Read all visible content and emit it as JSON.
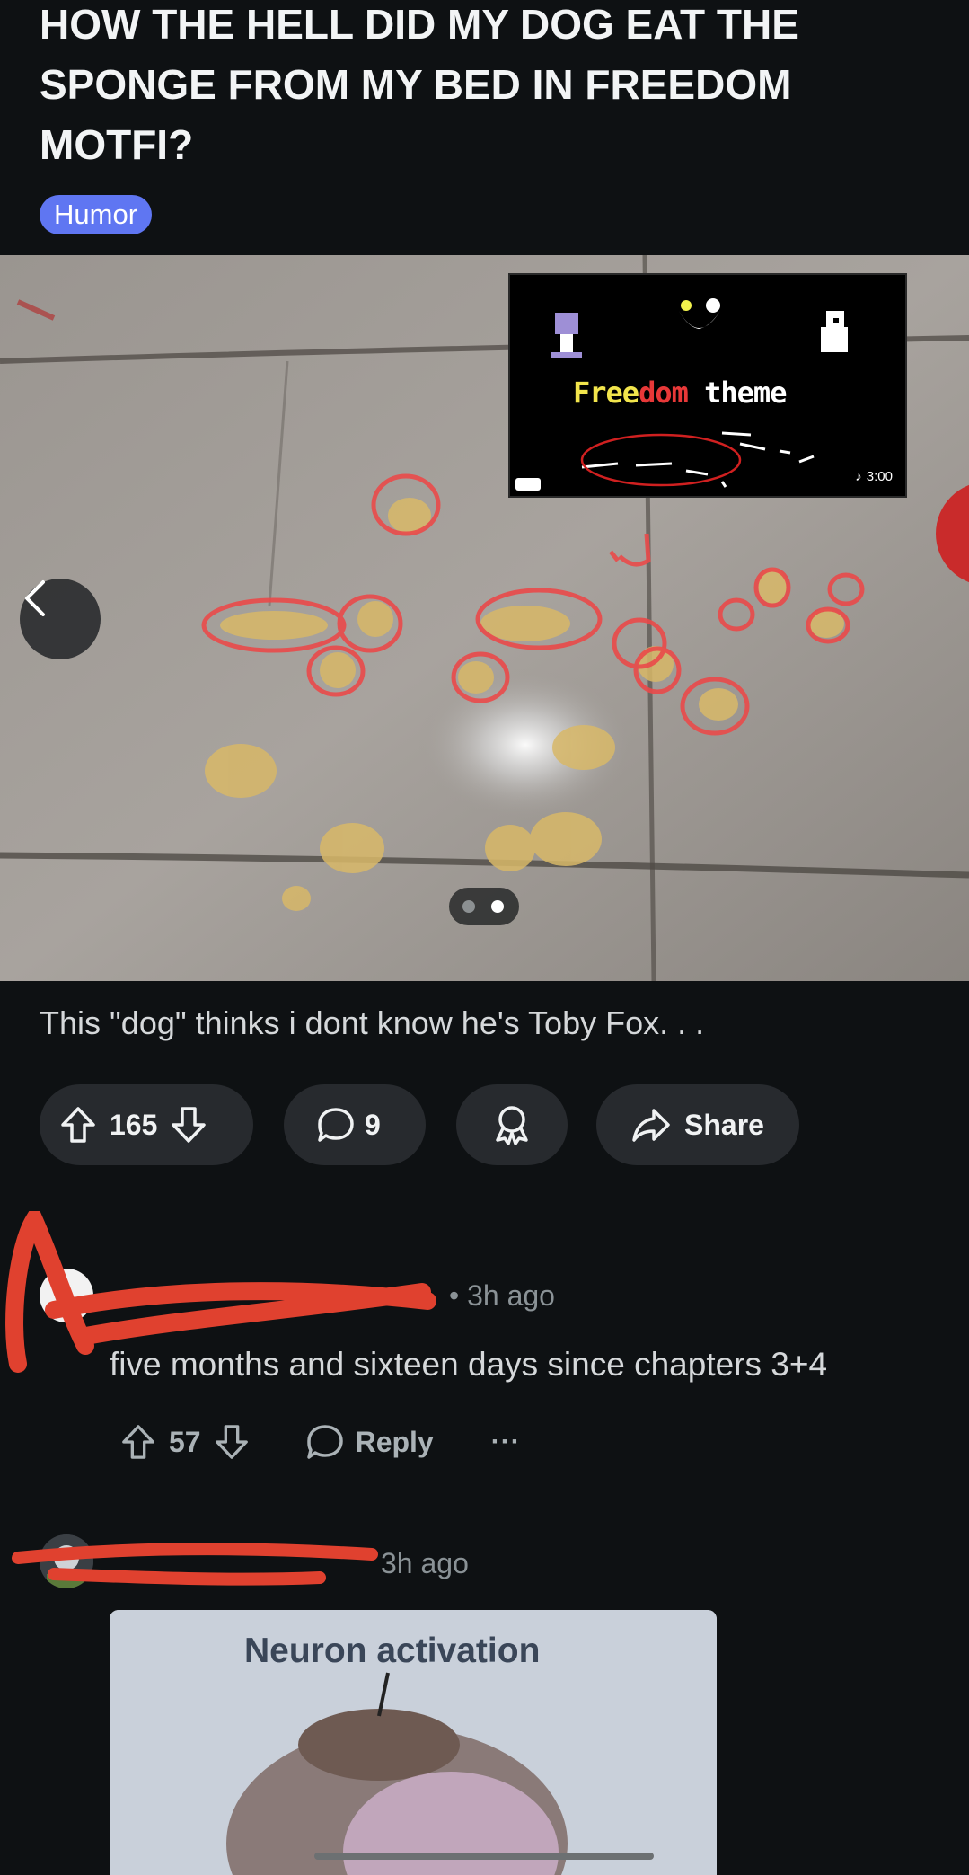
{
  "post": {
    "title": "HOW THE HELL DID MY DOG EAT THE SPONGE FROM MY BED IN FREEDOM MOTFI?",
    "flair": "Humor",
    "caption": "This \"dog\" thinks i dont know he's Toby Fox. . .",
    "inset": {
      "title_part1": "Free",
      "title_part2": "dom",
      "title_part3": " theme",
      "duration": "3:00"
    },
    "gallery": {
      "pages": 2,
      "current": 2
    }
  },
  "actions": {
    "upvotes": "165",
    "comments": "9",
    "share_label": "Share"
  },
  "comments": [
    {
      "time": "• 3h ago",
      "body": "five months and sixteen days since chapters 3+4",
      "votes": "57",
      "reply_label": "Reply",
      "more": "···"
    },
    {
      "time": "3h ago",
      "image_text": "Neuron activation"
    }
  ],
  "colors": {
    "background": "#0e1113",
    "flair": "#5f76f2",
    "pill": "#272a2e",
    "redaction": "#e0412f"
  }
}
